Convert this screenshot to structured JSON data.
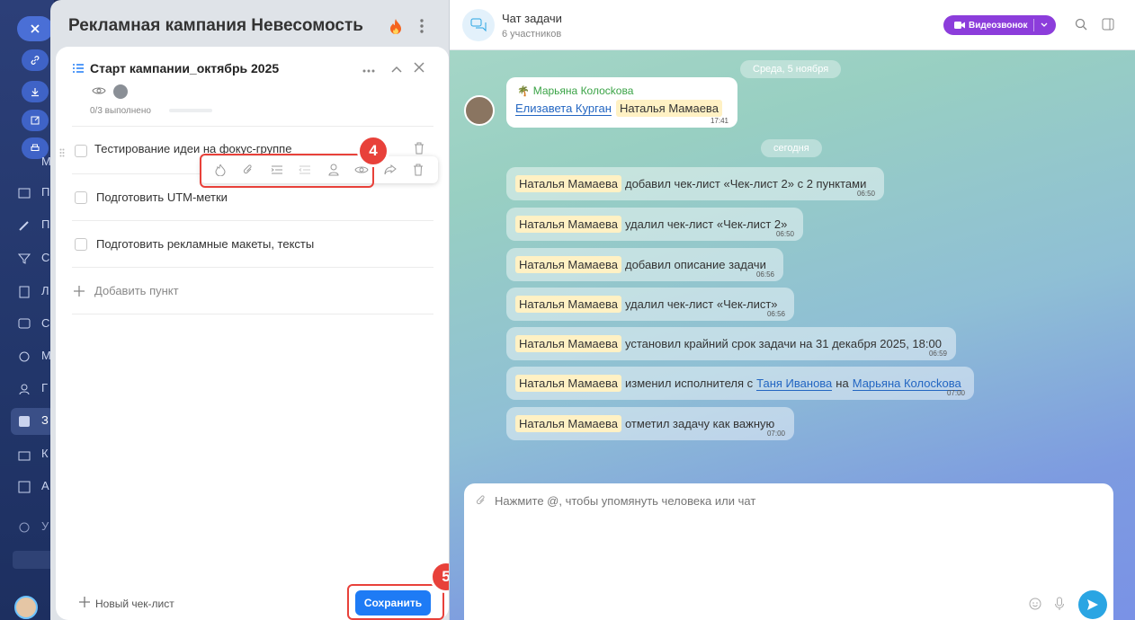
{
  "sidebar": {
    "labels": [
      "М",
      "П",
      "П",
      "С",
      "Л",
      "С",
      "М",
      "Г",
      "З",
      "К",
      "А",
      "У"
    ]
  },
  "task": {
    "title": "Рекламная кампания Невесомость",
    "checklist_title": "Старт кампании_октябрь 2025",
    "progress": "0/3 выполнено",
    "progress_fraction": 0,
    "items": [
      "Тестирование идеи на фокус-группе",
      "Подготовить UTM-метки",
      "Подготовить рекламные макеты, тексты"
    ],
    "add_item": "Добавить пункт",
    "new_checklist": "Новый чек-лист",
    "save": "Сохранить",
    "step4": "4",
    "step5": "5"
  },
  "chat": {
    "title": "Чат задачи",
    "participants": "6 участников",
    "video_call": "Видеозвонок",
    "date_old": "Среда, 5 ноября",
    "date_today": "сегодня",
    "first_message": {
      "author": "Марьяна Колосkова",
      "mention1": "Елизавета Курган",
      "mention2": "Наталья Мамаева",
      "time": "17:41"
    },
    "messages": [
      {
        "author": "Наталья Мамаева",
        "text": "добавил чек-лист «Чек-лист 2» с 2 пунктами",
        "time": "06:50"
      },
      {
        "author": "Наталья Мамаева",
        "text": "удалил чек-лист «Чек-лист 2»",
        "time": "06:50"
      },
      {
        "author": "Наталья Мамаева",
        "text": "добавил описание задачи",
        "time": "06:56"
      },
      {
        "author": "Наталья Мамаева",
        "text": "удалил чек-лист «Чек-лист»",
        "time": "06:56"
      },
      {
        "author": "Наталья Мамаева",
        "text": "установил крайний срок задачи на 31 декабря 2025, 18:00",
        "time": "06:59"
      },
      {
        "author": "Наталья Мамаева",
        "text_before": "изменил исполнителя с",
        "link1": "Таня Иванова",
        "text_mid": "на",
        "link2": "Марьяна Колосkова",
        "time": "07:00"
      },
      {
        "author": "Наталья Мамаева",
        "text": "отметил задачу как важную",
        "time": "07:00"
      }
    ],
    "input_placeholder": "Нажмите @, чтобы упомянуть человека или чат"
  },
  "colors": {
    "accent": "#1e7bf5",
    "video": "#8c3ddb",
    "highlight": "#e8413a",
    "fire": "#f4631f"
  }
}
